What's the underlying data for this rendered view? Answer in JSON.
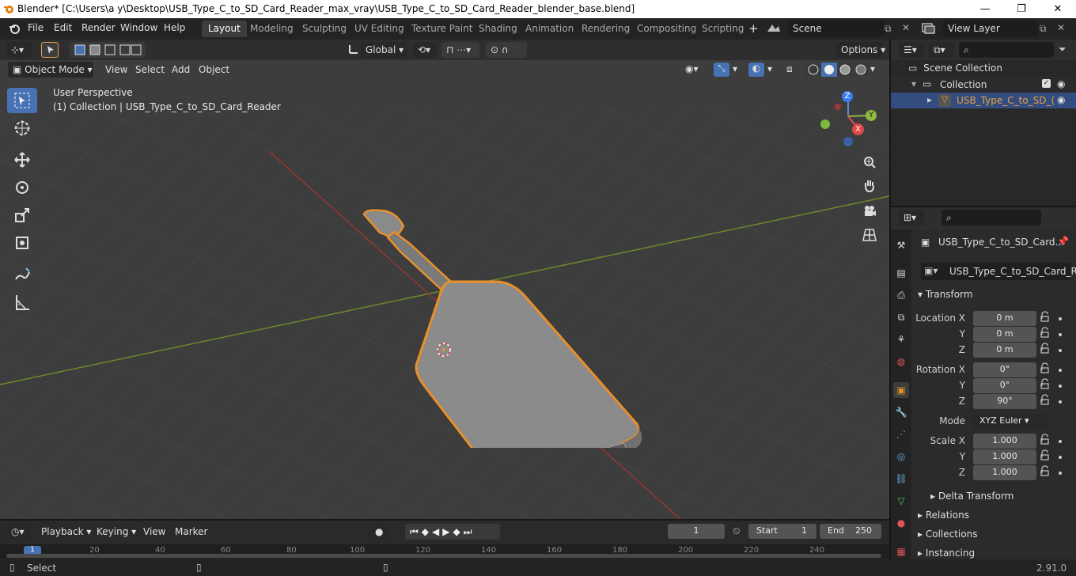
{
  "title": "Blender* [C:\\Users\\a y\\Desktop\\USB_Type_C_to_SD_Card_Reader_max_vray\\USB_Type_C_to_SD_Card_Reader_blender_base.blend]",
  "menu": [
    "File",
    "Edit",
    "Render",
    "Window",
    "Help"
  ],
  "workspaces": [
    "Layout",
    "Modeling",
    "Sculpting",
    "UV Editing",
    "Texture Paint",
    "Shading",
    "Animation",
    "Rendering",
    "Compositing",
    "Scripting"
  ],
  "scene": "Scene",
  "view_layer": "View Layer",
  "header": {
    "orientation": "Global",
    "options": "Options"
  },
  "viewport_menu": {
    "mode": "Object Mode",
    "view": "View",
    "select": "Select",
    "add": "Add",
    "object": "Object"
  },
  "overlay_text": {
    "perspective": "User Perspective",
    "collection_info": "(1) Collection | USB_Type_C_to_SD_Card_Reader"
  },
  "gizmo": {
    "x": "X",
    "y": "Y",
    "z": "Z"
  },
  "outliner": {
    "scene_collection": "Scene Collection",
    "collection": "Collection",
    "object": "USB_Type_C_to_SD_("
  },
  "properties": {
    "object_name": "USB_Type_C_to_SD_Card...",
    "data_name": "USB_Type_C_to_SD_Card_R...",
    "transform_label": "Transform",
    "location_label": "Location X",
    "location": [
      "0 m",
      "0 m",
      "0 m"
    ],
    "rotation_label": "Rotation X",
    "rotation": [
      "0°",
      "0°",
      "90°"
    ],
    "mode_label": "Mode",
    "mode": "XYZ Euler",
    "scale_label": "Scale X",
    "scale": [
      "1.000",
      "1.000",
      "1.000"
    ],
    "axis_y": "Y",
    "axis_z": "Z",
    "delta": "Delta Transform",
    "relations": "Relations",
    "collections": "Collections",
    "instancing": "Instancing"
  },
  "timeline": {
    "playback": "Playback",
    "keying": "Keying",
    "view": "View",
    "marker": "Marker",
    "current_frame": "1",
    "start_label": "Start",
    "start": "1",
    "end_label": "End",
    "end": "250",
    "ticks": [
      "1",
      "20",
      "40",
      "60",
      "80",
      "100",
      "120",
      "140",
      "160",
      "180",
      "200",
      "220",
      "240"
    ]
  },
  "status": {
    "select": "Select",
    "version": "2.91.0"
  }
}
